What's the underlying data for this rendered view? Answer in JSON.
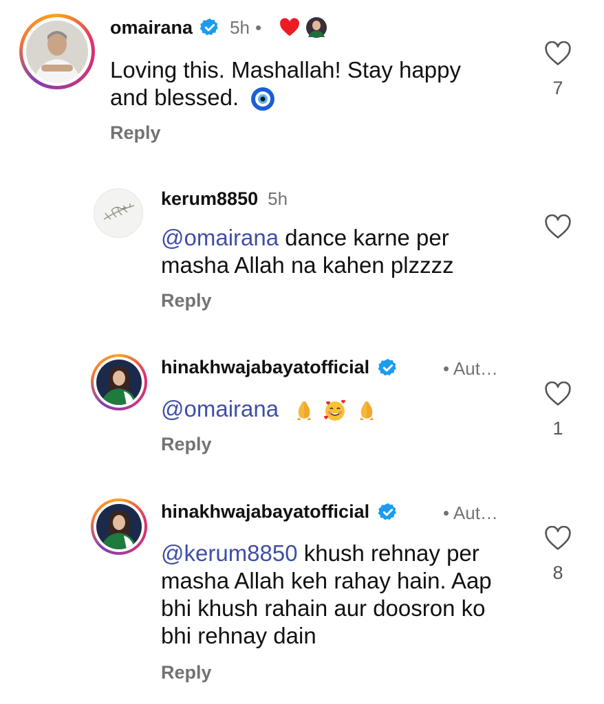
{
  "comments": [
    {
      "username": "omairana",
      "time": "5h",
      "dot": "•",
      "body_lines": [
        "Loving this. Mashallah! Stay happy",
        "and blessed."
      ],
      "reply": "Reply",
      "likes": "7",
      "liked_by_author": true
    },
    {
      "username": "kerum8850",
      "time": "5h",
      "mention": "@omairana",
      "body_lines": [
        " dance karne per",
        "masha Allah na kahen plzzzz"
      ],
      "reply": "Reply",
      "likes": ""
    },
    {
      "username": "hinakhwajabayatofficial",
      "author_tag": "• Aut…",
      "mention": "@omairana",
      "body_lines": [
        ""
      ],
      "reply": "Reply",
      "likes": "1"
    },
    {
      "username": "hinakhwajabayatofficial",
      "author_tag": "• Aut…",
      "mention": "@kerum8850",
      "body_lines": [
        " khush rehnay per",
        "masha Allah keh rahay hain. Aap",
        "bhi khush rahain aur doosron ko",
        "bhi rehnay dain"
      ],
      "reply": "Reply",
      "likes": "8"
    }
  ],
  "colors": {
    "mention": "#3f4ea8",
    "muted": "#737373",
    "verified": "#1d9bf0",
    "heart": "#ed1c24"
  },
  "icons": [
    "heart-outline-icon",
    "verified-badge-icon",
    "heart-filled-icon",
    "nazar-amulet-icon",
    "folded-hands-icon",
    "smiling-face-with-hearts-icon"
  ]
}
